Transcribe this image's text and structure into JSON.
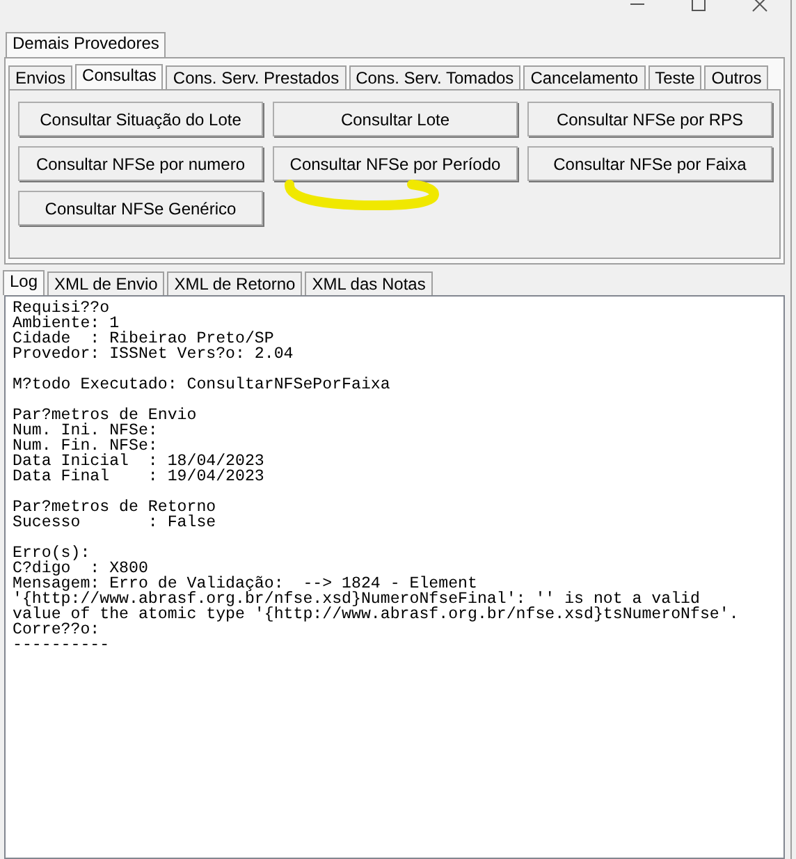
{
  "outer_tabs": [
    {
      "label": "Demais Provedores",
      "selected": true
    }
  ],
  "tabs": [
    {
      "label": "Envios",
      "selected": false
    },
    {
      "label": "Consultas",
      "selected": true
    },
    {
      "label": "Cons. Serv. Prestados",
      "selected": false
    },
    {
      "label": "Cons. Serv. Tomados",
      "selected": false
    },
    {
      "label": "Cancelamento",
      "selected": false
    },
    {
      "label": "Teste",
      "selected": false
    },
    {
      "label": "Outros",
      "selected": false
    }
  ],
  "buttons": [
    {
      "label": "Consultar Situação do Lote",
      "circled": false
    },
    {
      "label": "Consultar Lote",
      "circled": false
    },
    {
      "label": "Consultar NFSe por RPS",
      "circled": false
    },
    {
      "label": "Consultar NFSe por numero",
      "circled": false
    },
    {
      "label": "Consultar NFSe por Período",
      "circled": true
    },
    {
      "label": "Consultar NFSe por Faixa",
      "circled": false
    },
    {
      "label": "Consultar NFSe Genérico",
      "circled": false
    }
  ],
  "log_tabs": [
    {
      "label": "Log",
      "selected": true
    },
    {
      "label": "XML de Envio",
      "selected": false
    },
    {
      "label": "XML de Retorno",
      "selected": false
    },
    {
      "label": "XML das Notas",
      "selected": false
    }
  ],
  "log": [
    [
      "Requisi??o",
      "Ambiente: 1",
      "Cidade  : Ribeirao Preto/SP",
      "Provedor: ISSNet Vers?o: 2.04"
    ],
    [
      "M?todo Executado: ConsultarNFSePorFaixa"
    ],
    [
      "Par?metros de Envio",
      "Num. Ini. NFSe:",
      "Num. Fin. NFSe:",
      "Data Inicial  : 18/04/2023",
      "Data Final    : 19/04/2023"
    ],
    [
      "Par?metros de Retorno",
      "Sucesso       : False"
    ],
    [
      "Erro(s):",
      "C?digo  : X800",
      "Mensagem: Erro de Validação:  --> 1824 - Element",
      "'{http://www.abrasf.org.br/nfse.xsd}NumeroNfseFinal': '' is not a valid",
      "value of the atomic type '{http://www.abrasf.org.br/nfse.xsd}tsNumeroNfse'.",
      "Corre??o:",
      "----------"
    ]
  ]
}
